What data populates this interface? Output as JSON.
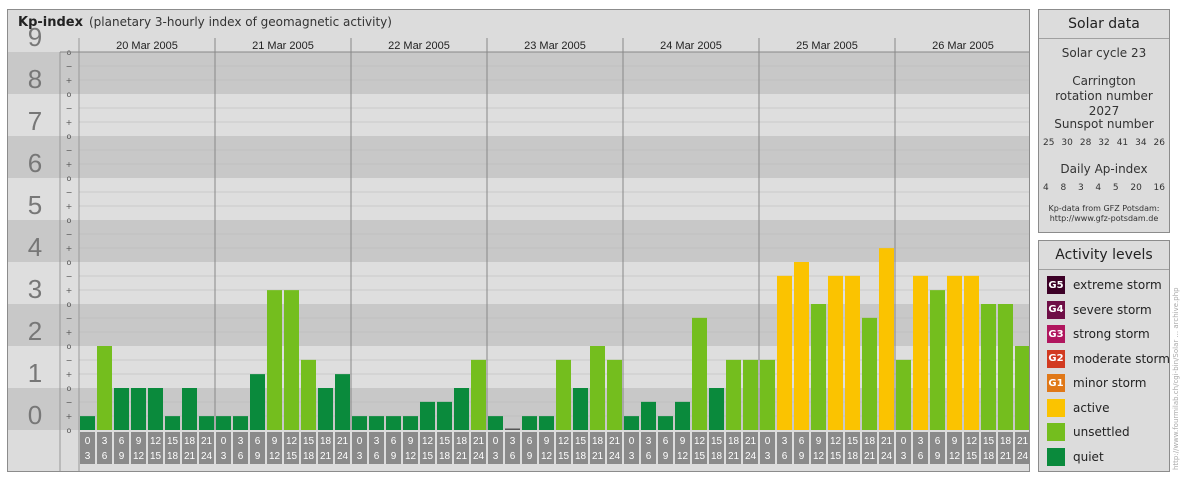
{
  "header": {
    "title": "Kp-index",
    "subtitle": "(planetary 3-hourly index of geomagnetic activity)"
  },
  "chart_data": {
    "type": "bar",
    "title": "Kp-index",
    "subtitle": "(planetary 3-hourly index of geomagnetic activity)",
    "ylim": [
      0,
      9
    ],
    "y_ticks": [
      "0",
      "1",
      "2",
      "3",
      "4",
      "5",
      "6",
      "7",
      "8",
      "9"
    ],
    "sub_ticks": [
      "o",
      "+",
      "−"
    ],
    "days": [
      "20 Mar 2005",
      "21 Mar 2005",
      "22 Mar 2005",
      "23 Mar 2005",
      "24 Mar 2005",
      "25 Mar 2005",
      "26 Mar 2005"
    ],
    "interval_top": [
      "0",
      "3",
      "6",
      "9",
      "12",
      "15",
      "18",
      "21"
    ],
    "interval_bottom": [
      "3",
      "6",
      "9",
      "12",
      "15",
      "18",
      "21",
      "24"
    ],
    "values": [
      0.33,
      2.0,
      1.0,
      1.0,
      1.0,
      0.33,
      1.0,
      0.33,
      0.33,
      0.33,
      1.33,
      3.33,
      3.33,
      1.67,
      1.0,
      1.33,
      0.33,
      0.33,
      0.33,
      0.33,
      0.67,
      0.67,
      1.0,
      1.67,
      0.33,
      0.0,
      0.33,
      0.33,
      1.67,
      1.0,
      2.0,
      1.67,
      0.33,
      0.67,
      0.33,
      0.67,
      2.67,
      1.0,
      1.67,
      1.67,
      1.67,
      3.67,
      4.0,
      3.0,
      3.67,
      3.67,
      2.67,
      4.33,
      1.67,
      3.67,
      3.33,
      3.67,
      3.67,
      3.0,
      3.0,
      2.0
    ],
    "grid": true,
    "colors": {
      "quiet": "#0a8a3c",
      "unsettled": "#74be1e",
      "active": "#fbc300",
      "g1": "#e07818",
      "g2": "#d23a20",
      "g3": "#b0165e",
      "g4": "#6e0e46",
      "g5": "#3c0026"
    }
  },
  "solar": {
    "title": "Solar data",
    "cycle": "Solar cycle 23",
    "carrington": "Carrington rotation number 2027",
    "sunspot_label": "Sunspot number",
    "sunspot_values": [
      "25",
      "30",
      "28",
      "32",
      "41",
      "34",
      "26"
    ],
    "ap_label": "Daily Ap-index",
    "ap_values": [
      "4",
      "8",
      "3",
      "4",
      "5",
      "20",
      "16"
    ],
    "source_line1": "Kp-data from GFZ Potsdam:",
    "source_line2": "http://www.gfz-potsdam.de"
  },
  "activity": {
    "title": "Activity levels",
    "levels": [
      {
        "badge": "G5",
        "label": "extreme storm",
        "color": "#3c0026"
      },
      {
        "badge": "G4",
        "label": "severe storm",
        "color": "#6e0e46"
      },
      {
        "badge": "G3",
        "label": "strong storm",
        "color": "#b0165e"
      },
      {
        "badge": "G2",
        "label": "moderate storm",
        "color": "#d23a20"
      },
      {
        "badge": "G1",
        "label": "minor storm",
        "color": "#e07818"
      },
      {
        "badge": "",
        "label": "active",
        "color": "#fbc300"
      },
      {
        "badge": "",
        "label": "unsettled",
        "color": "#74be1e"
      },
      {
        "badge": "",
        "label": "quiet",
        "color": "#0a8a3c"
      }
    ]
  },
  "credit": "http://www.fourmilab.ch/cgi-bin/Solar ... archive.php"
}
